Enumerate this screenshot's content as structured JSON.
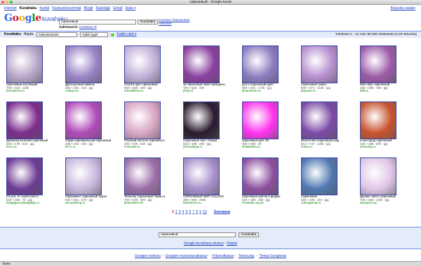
{
  "window_title": "сиреневый - Google-kuvat",
  "topnav": [
    "Internet",
    "Kuvahaku",
    "Kartat",
    "Keskusteluryhmät",
    "Blogit",
    "Kääntäjä",
    "Gmail",
    "lisää ▾"
  ],
  "signin": "Kirjaudu sisään",
  "logo": {
    "google": "Google",
    "suffix": "kuvahaku"
  },
  "search": {
    "value": "сиреневый",
    "button": "Kuvahaku",
    "advanced": "Kuvahaun lisäasetukset",
    "settings": "Asetukset"
  },
  "safesearch": {
    "label": "SafeSearch:",
    "value": "Keskitaso ▾"
  },
  "resultsbar": {
    "title": "Kuvahaku",
    "show_label": "Näytä:",
    "size_select": "Kaikenkokoiset",
    "type_select": "Kaikki tyypit",
    "color_link": "Kaikki värit ▾",
    "stats": "Tuloksset 1 - 21 noin 90 900 tuloksesta (0,19 sekuntia)"
  },
  "colors": {
    "link": "#1a3dc1",
    "site": "#008000",
    "bar": "#e5ecf9"
  },
  "results": [
    {
      "title": "сиреневым коллекция",
      "size": "700 × 623 - 118k",
      "site": "liveinternet.ru",
      "color": "#b8a6c8"
    },
    {
      "title": "Драгоценный камень",
      "size": "300 × 282 - 21k - jpg",
      "site": "rusloys.ru",
      "color": "#9a84c6"
    },
    {
      "title": "041015 цвет сиреневый",
      "size": "600 × 500 - 26k - jpg",
      "site": "rukodelie4u.ru",
      "color": "#c1b0d8"
    },
    {
      "title": "за сиреневый пакет женщины",
      "size": "700 × 525 - 20k",
      "site": "photo.fr",
      "color": "#8a3f9e"
    },
    {
      "title": "фото Сиреневый Цвет",
      "size": "600 × 601 - 174k - jpg",
      "site": "photoforum.ru",
      "color": "#8c7bc0"
    },
    {
      "title": "Сиреневый туман",
      "size": "800 × 571 - 210k - jpg",
      "site": "playcast.ru",
      "color": "#b78fd0"
    },
    {
      "title": "Мак гибр. сиреневый",
      "size": "336 × 386 - 45k - jpg",
      "site": "bdtr.ru",
      "color": "#9c5aa7"
    },
    {
      "title": "Джемпер женский сиреневый",
      "size": "400 × 478 - 81k - jpg",
      "site": "be-in.ru",
      "color": "#7b2d8c"
    },
    {
      "title": "Парик карнавальный сиреневый",
      "size": "338 × 400 - 34k - jpg",
      "site": "be-in.ru",
      "color": "#b04bb8"
    },
    {
      "title": "Розовый пастель сиреневого",
      "size": "400 × 400 - 52k - jpg",
      "site": "it-woman.ru",
      "color": "#d8a6c4"
    },
    {
      "title": "Сиреневый Аист. Опции",
      "size": "533 × 498 - 26k - jpg",
      "site": "johnnydepp.ru",
      "color": "#2a1b2e"
    },
    {
      "title": "сиреневый цвет 35",
      "size": "800 × 600 - 2k",
      "site": "antitabinka.ru",
      "color": "#ff33ee"
    },
    {
      "title": "Фиолетово-сиреневый шар",
      "size": "813 × 747 - 120k - jpg",
      "site": "horse.ru",
      "color": "#7b4aa6"
    },
    {
      "title": "и кислород сиреневый",
      "size": "336 × 486 - 60k - jpg",
      "site": "elementy.ru",
      "color": "#c8532e"
    },
    {
      "title": "for you- от cards.mail.ru",
      "size": "640 × 350 - 7k - jpg",
      "site": "loragaga.myliveppage.ru",
      "color": "#6d3b95"
    },
    {
      "title": "Парламент. сиреневый туман",
      "size": "640 × 561 - 57k - jpg",
      "site": "wm-painting.ru",
      "color": "#c8b8dc"
    },
    {
      "title": "Тюльпан Сиреневый Туман в",
      "size": "700 × 525 - 30k - jpg",
      "site": "photostart.info",
      "color": "#9b6ea8"
    },
    {
      "title": "СИРЕНЕВЫЙ МИР CALLING",
      "size": "400 × 500 - 293k",
      "site": "liveinternet.ru",
      "color": "#a68fcb"
    },
    {
      "title": "сиреневый цветок в форме",
      "size": "640 × 480 - 48k - jpg",
      "site": "mvstudio.org.ua",
      "color": "#8c4f9e"
    },
    {
      "title": "Сиреневый",
      "size": "520 × 400 - 31k - jpg",
      "site": "vokrugsveta.ru",
      "color": "#4f78b0"
    },
    {
      "title": "Дизайн сайта Сиреневый",
      "size": "700 × 926 - 118k - jpg",
      "site": "inproject.org",
      "color": "#e0c6e6"
    }
  ],
  "pager": {
    "pages": [
      "1",
      "2",
      "3",
      "4",
      "5",
      "6",
      "7",
      "8",
      "9",
      "10"
    ],
    "next": "Seuraava"
  },
  "bottom": {
    "search_value": "сиреневый",
    "button": "Kuvahaku",
    "help": "Google-kuvahaun etusivu",
    "sep": " - ",
    "help2": "Ohjeet"
  },
  "footer": [
    "Googlen kotisivu",
    "Googlen mainontaratkaisut",
    "Yritysratkaisut",
    "Tietosuoja",
    "Tietoja Googlesta"
  ],
  "status": "Done"
}
